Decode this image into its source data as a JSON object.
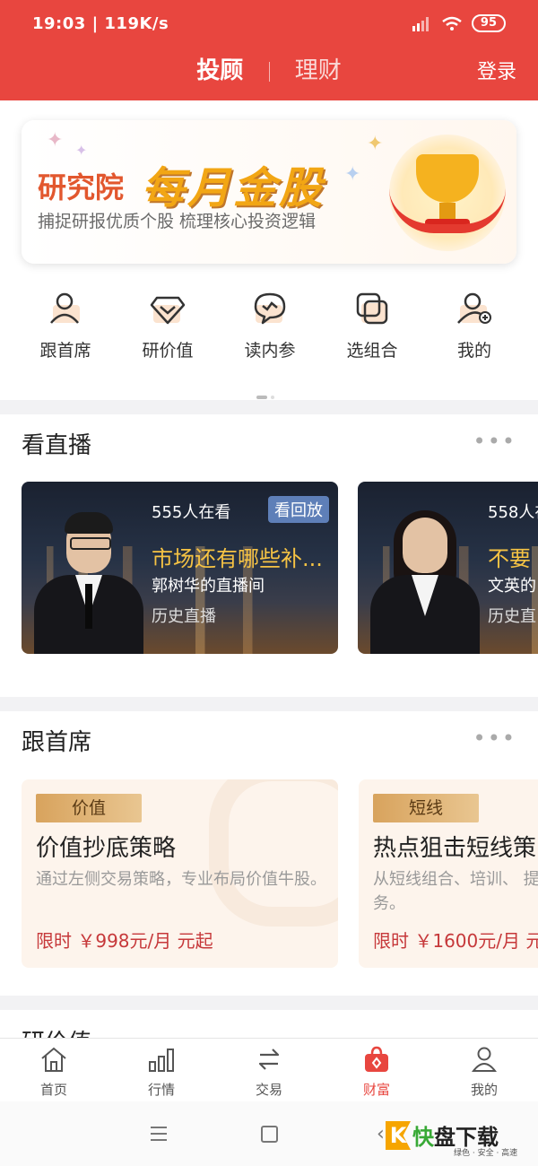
{
  "status_bar": {
    "time_speed": "19:03 | 119K/s",
    "battery": "95"
  },
  "header": {
    "tab_active": "投顾",
    "tab_inactive": "理财",
    "login": "登录"
  },
  "banner": {
    "brand": "研究院",
    "title": "每月金股",
    "subtitle": "捕捉研报优质个股    梳理核心投资逻辑"
  },
  "quick_links": [
    {
      "label": "跟首席",
      "icon": "advisor-icon"
    },
    {
      "label": "研价值",
      "icon": "value-icon"
    },
    {
      "label": "读内参",
      "icon": "chat-icon"
    },
    {
      "label": "选组合",
      "icon": "portfolio-icon"
    },
    {
      "label": "我的",
      "icon": "my-icon"
    }
  ],
  "live_section": {
    "title": "看直播",
    "more": "•••",
    "cards": [
      {
        "viewers": "555人在看",
        "badge": "看回放",
        "title": "市场还有哪些补...",
        "room": "郭树华的直播间",
        "history": "历史直播"
      },
      {
        "viewers": "558人在",
        "title": "不要",
        "room": "文英的",
        "history": "历史直"
      }
    ]
  },
  "chief_section": {
    "title": "跟首席",
    "more": "•••",
    "cards": [
      {
        "tag": "价值",
        "title": "价值抄底策略",
        "desc": "通过左侧交易策略，专业布局价值牛股。",
        "price": "限时 ￥998元/月 元起"
      },
      {
        "tag": "短线",
        "title": "热点狙击短线策",
        "desc": "从短线组合、培训、 提供专业投资服务。",
        "price": "限时 ￥1600元/月 元"
      }
    ]
  },
  "next_section_title": "研价值",
  "bottom_nav": [
    {
      "label": "首页",
      "icon": "home-icon",
      "active": false
    },
    {
      "label": "行情",
      "icon": "market-icon",
      "active": false
    },
    {
      "label": "交易",
      "icon": "trade-icon",
      "active": false
    },
    {
      "label": "财富",
      "icon": "wealth-icon",
      "active": true
    },
    {
      "label": "我的",
      "icon": "profile-icon",
      "active": false
    }
  ],
  "watermark": {
    "main_1": "快",
    "main_2": "盘下载",
    "sub": "绿色 · 安全 · 高速"
  },
  "colors": {
    "brand_red": "#e8463f",
    "gold": "#f6c344",
    "price_red": "#c6383a"
  }
}
